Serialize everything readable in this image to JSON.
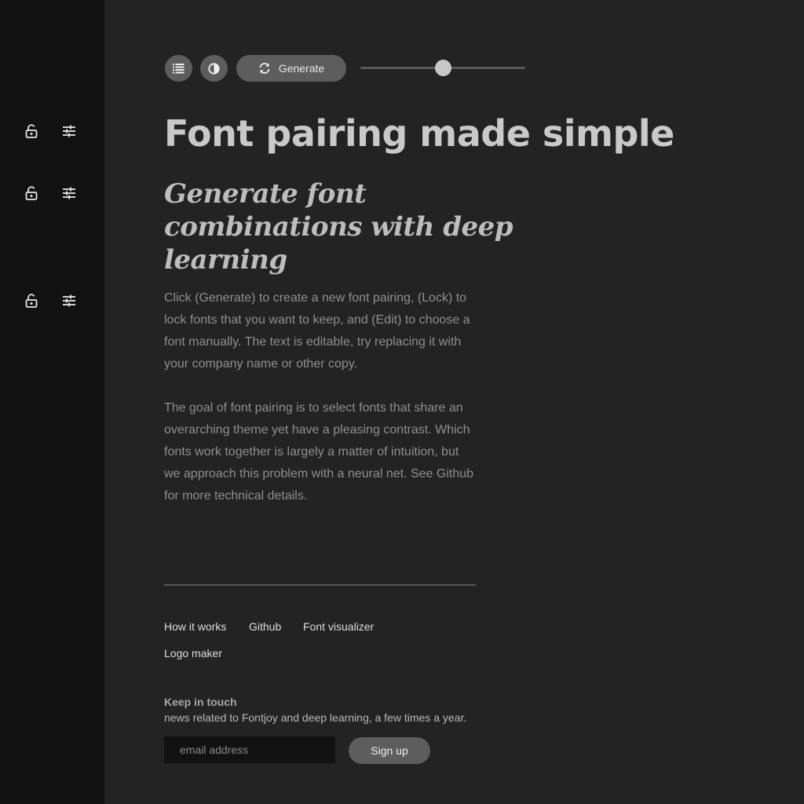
{
  "toolbar": {
    "list_icon": "list-icon",
    "contrast_icon": "contrast-icon",
    "generate_icon": "refresh-icon",
    "generate_label": "Generate",
    "slider_value": 0.5
  },
  "sidebar": {
    "rows": [
      {
        "lock_icon": "lock-icon",
        "edit_icon": "sliders-icon"
      },
      {
        "lock_icon": "lock-icon",
        "edit_icon": "sliders-icon"
      },
      {
        "lock_icon": "lock-icon",
        "edit_icon": "sliders-icon"
      }
    ]
  },
  "content": {
    "headline": "Font pairing made simple",
    "subheadline": "Generate font combinations with deep learning",
    "paragraphs": [
      "Click (Generate) to create a new font pairing, (Lock) to lock fonts that you want to keep, and (Edit) to choose a font manually. The text is editable, try replacing it with your company name or other copy.",
      "The goal of font pairing is to select fonts that share an overarching theme yet have a pleasing contrast. Which fonts work together is largely a matter of intuition, but we approach this problem with a neural net. See Github for more technical details."
    ]
  },
  "footer": {
    "links": [
      "How it works",
      "Github",
      "Font visualizer",
      "Logo maker"
    ],
    "keep_title": "Keep in touch",
    "keep_desc": "news related to Fontjoy and deep learning, a few times a year.",
    "email_placeholder": "email address",
    "signup_label": "Sign up"
  },
  "colors": {
    "background": "#232323",
    "sidebar": "#121212",
    "button": "#5d5d5d"
  }
}
